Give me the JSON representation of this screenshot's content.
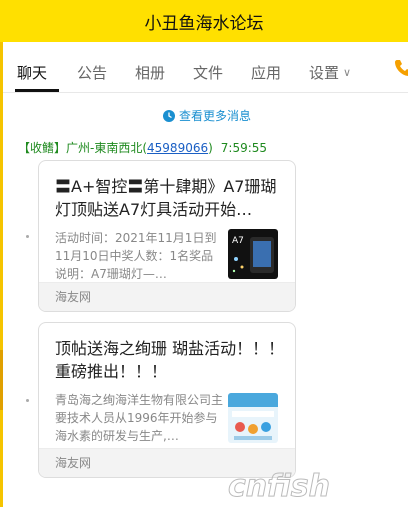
{
  "header": {
    "title": "小丑鱼海水论坛"
  },
  "tabs": [
    {
      "label": "聊天",
      "active": true
    },
    {
      "label": "公告"
    },
    {
      "label": "相册"
    },
    {
      "label": "文件"
    },
    {
      "label": "应用"
    },
    {
      "label": "设置"
    }
  ],
  "more_messages": "查看更多消息",
  "message": {
    "sender": "【收鳍】广州-東南西北",
    "sender_id": "45989066",
    "time": "7:59:55"
  },
  "cards": [
    {
      "title": "〓A+智控〓第十肆期》A7珊瑚灯顶贴送A7灯具活动开始…",
      "desc": "活动时间：2021年11月1日到11月10日中奖人数：1名奖品说明：A7珊瑚灯—…",
      "source": "海友网",
      "thumb_text": "A7"
    },
    {
      "title": "顶帖送海之绚珊 瑚盐活动！！！ 重磅推出！！！",
      "desc": "青岛海之绚海洋生物有限公司主要技术人员从1996年开始参与海水素的研发与生产,…",
      "source": "海友网"
    }
  ],
  "watermark": "cnfish",
  "colors": {
    "header_bg": "#ffe000",
    "accent_green": "#1f8a1f",
    "link_blue": "#1a8fd0"
  }
}
